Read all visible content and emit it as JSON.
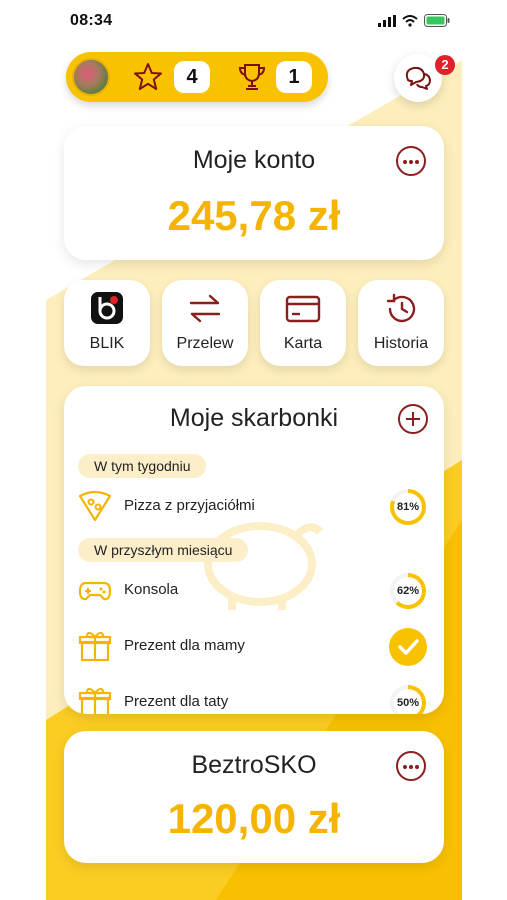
{
  "status_bar": {
    "time": "08:34"
  },
  "header": {
    "stars_count": "4",
    "trophies_count": "1",
    "notifications_badge": "2"
  },
  "account": {
    "title": "Moje konto",
    "balance": "245,78 zł"
  },
  "quick_actions": [
    {
      "label": "BLIK",
      "icon": "blik-icon"
    },
    {
      "label": "Przelew",
      "icon": "transfer-arrows-icon"
    },
    {
      "label": "Karta",
      "icon": "card-icon"
    },
    {
      "label": "Historia",
      "icon": "history-icon"
    }
  ],
  "piggy_banks": {
    "title": "Moje skarbonki",
    "sections": [
      {
        "label": "W tym tygodniu"
      },
      {
        "label": "W przyszłym miesiącu"
      }
    ],
    "items": [
      {
        "name": "Pizza z przyjaciółmi",
        "progress": 81,
        "progress_label": "81%",
        "icon": "pizza-icon"
      },
      {
        "name": "Konsola",
        "progress": 62,
        "progress_label": "62%",
        "icon": "gamepad-icon"
      },
      {
        "name": "Prezent dla mamy",
        "progress": 100,
        "completed": true,
        "icon": "gift-icon"
      },
      {
        "name": "Prezent dla taty",
        "progress": 50,
        "progress_label": "50%",
        "icon": "gift-icon"
      }
    ]
  },
  "beztrosko": {
    "title": "BeztroSKO",
    "balance": "120,00 zł"
  },
  "colors": {
    "accent": "#f9c200",
    "amount": "#f5b400",
    "icon_dark_red": "#8b1e1e",
    "badge_red": "#e0202a"
  }
}
